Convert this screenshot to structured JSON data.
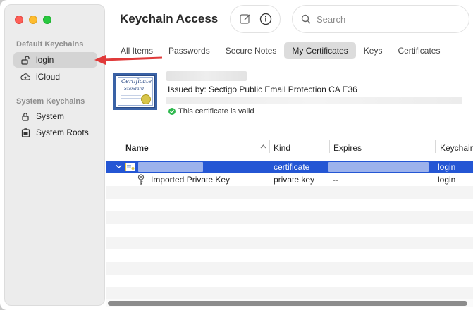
{
  "window": {
    "title": "Keychain Access"
  },
  "toolbar": {
    "new_icon": "compose-icon",
    "info_icon": "info-icon",
    "search_placeholder": "Search"
  },
  "sidebar": {
    "default_title": "Default Keychains",
    "default_items": [
      {
        "label": "login",
        "icon": "unlocked-padlock-icon",
        "selected": true
      },
      {
        "label": "iCloud",
        "icon": "cloud-icon",
        "selected": false
      }
    ],
    "system_title": "System Keychains",
    "system_items": [
      {
        "label": "System",
        "icon": "padlock-icon"
      },
      {
        "label": "System Roots",
        "icon": "cabinet-icon"
      }
    ]
  },
  "tabs": [
    {
      "label": "All Items",
      "active": false
    },
    {
      "label": "Passwords",
      "active": false
    },
    {
      "label": "Secure Notes",
      "active": false
    },
    {
      "label": "My Certificates",
      "active": true
    },
    {
      "label": "Keys",
      "active": false
    },
    {
      "label": "Certificates",
      "active": false
    }
  ],
  "certificate": {
    "icon_text_1": "Certificate",
    "icon_text_2": "Standard",
    "issued_by": "Issued by: Sectigo Public Email Protection CA E36",
    "status": "This certificate is valid"
  },
  "table": {
    "columns": [
      "Name",
      "Kind",
      "Expires",
      "Keychain"
    ],
    "rows": [
      {
        "name": "",
        "kind": "certificate",
        "expires": "",
        "keychain": "login",
        "selected": true
      },
      {
        "name": "Imported Private Key",
        "kind": "private key",
        "expires": "--",
        "keychain": "login",
        "selected": false
      }
    ]
  },
  "colors": {
    "selection": "#2456d4",
    "annotation_arrow": "#e03a3a"
  }
}
